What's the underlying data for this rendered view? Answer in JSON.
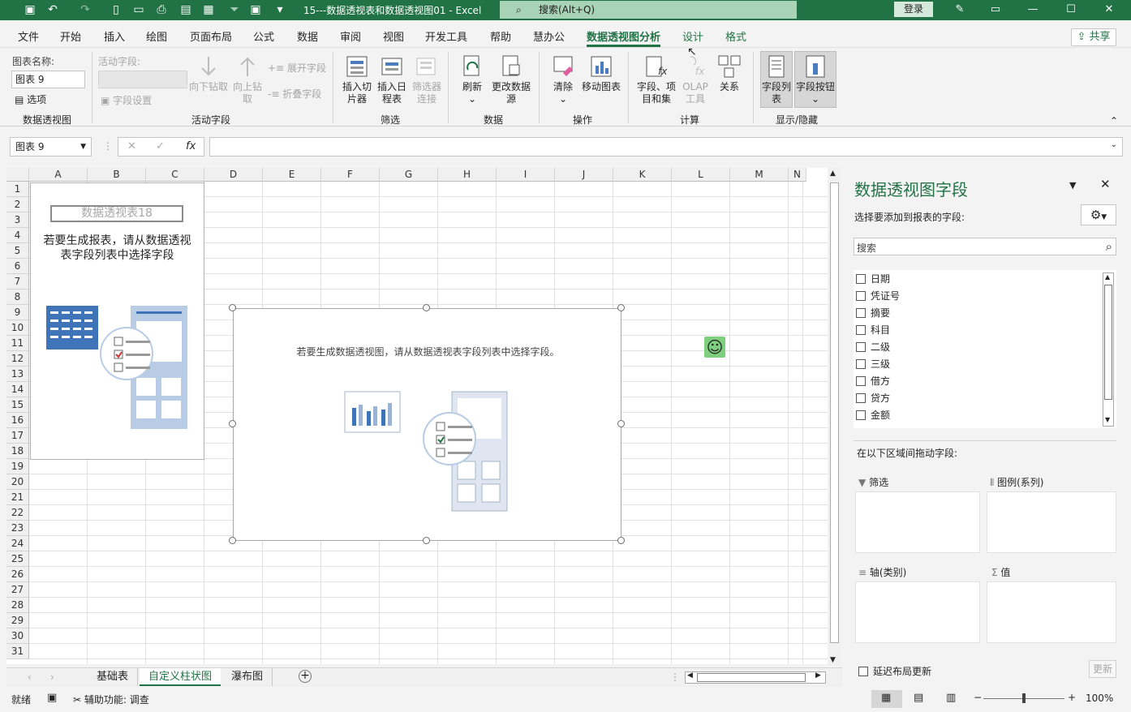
{
  "titlebar": {
    "title": "15---数据透视表和数据透视图01  -  Excel",
    "search_placeholder": "搜索(Alt+Q)",
    "login": "登录"
  },
  "menu": [
    "文件",
    "开始",
    "插入",
    "绘图",
    "页面布局",
    "公式",
    "数据",
    "审阅",
    "视图",
    "开发工具",
    "帮助",
    "慧办公",
    "数据透视图分析",
    "设计",
    "格式"
  ],
  "share": "共享",
  "ribbon": {
    "chart_name_label": "图表名称:",
    "chart_name_value": "图表 9",
    "options": "选项",
    "group_pivotchart": "数据透视图",
    "active_field_label": "活动字段:",
    "drill_down": "向下钻取",
    "drill_up": "向上钻取",
    "expand_field": "展开字段",
    "collapse_field": "折叠字段",
    "field_settings": "字段设置",
    "group_active_field": "活动字段",
    "insert_slicer": "插入切片器",
    "insert_timeline": "插入日程表",
    "filter_connections": "筛选器连接",
    "group_filter": "筛选",
    "refresh": "刷新",
    "change_source": "更改数据源",
    "group_data": "数据",
    "clear": "清除",
    "move_chart": "移动图表",
    "group_actions": "操作",
    "fields_items_sets": "字段、项目和集",
    "olap_tools": "OLAP工具",
    "relationships": "关系",
    "group_calc": "计算",
    "field_list": "字段列表",
    "field_buttons": "字段按钮",
    "group_showhide": "显示/隐藏"
  },
  "formula_bar": {
    "name_box": "图表 9",
    "fx": "fx"
  },
  "columns": [
    "A",
    "B",
    "C",
    "D",
    "E",
    "F",
    "G",
    "H",
    "I",
    "J",
    "K",
    "L",
    "M",
    "N"
  ],
  "rows": [
    "1",
    "2",
    "3",
    "4",
    "5",
    "6",
    "7",
    "8",
    "9",
    "10",
    "11",
    "12",
    "13",
    "14",
    "15",
    "16",
    "17",
    "18",
    "19",
    "20",
    "21",
    "22",
    "23",
    "24",
    "25",
    "26",
    "27",
    "28",
    "29",
    "30",
    "31"
  ],
  "pivot_placeholder": {
    "name": "数据透视表18",
    "text_line1": "若要生成报表，请从数据透视",
    "text_line2": "表字段列表中选择字段"
  },
  "chart_placeholder": {
    "text": "若要生成数据透视图，请从数据透视表字段列表中选择字段。"
  },
  "sheet_tabs": [
    "基础表",
    "自定义柱状图",
    "瀑布图"
  ],
  "status": {
    "ready": "就绪",
    "accessibility": "辅助功能: 调查",
    "zoom": "100%"
  },
  "pane": {
    "title": "数据透视图字段",
    "subtitle": "选择要添加到报表的字段:",
    "search_placeholder": "搜索",
    "fields": [
      "日期",
      "凭证号",
      "摘要",
      "科目",
      "二级",
      "三级",
      "借方",
      "贷方",
      "金额"
    ],
    "drag_label": "在以下区域间拖动字段:",
    "zone_filter": "筛选",
    "zone_legend": "图例(系列)",
    "zone_axis": "轴(类别)",
    "zone_values": "值",
    "defer_update": "延迟布局更新",
    "update_button": "更新"
  },
  "colors": {
    "accent": "#217346",
    "search_bg": "#a9d3b6"
  }
}
